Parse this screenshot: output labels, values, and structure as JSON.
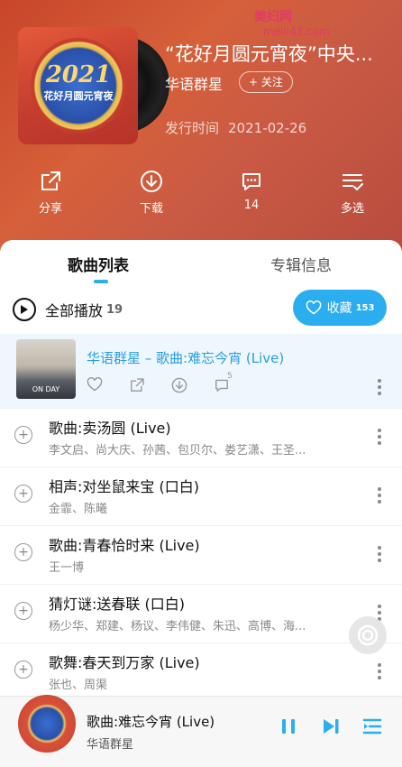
{
  "watermark": {
    "line1": "美妇网",
    "line2": "meili43.com"
  },
  "album": {
    "title": "“花好月圆元宵夜”中央...",
    "artist": "华语群星",
    "follow_label": "+ 关注",
    "release_label": "发行时间",
    "release_date": "2021-02-26",
    "cover_year": "2021",
    "cover_text": "花好月圆元宵夜"
  },
  "actions": [
    {
      "label": "分享",
      "icon": "share-icon"
    },
    {
      "label": "下载",
      "icon": "download-icon"
    },
    {
      "label": "14",
      "icon": "comment-icon"
    },
    {
      "label": "多选",
      "icon": "multi-select-icon"
    }
  ],
  "tabs": {
    "songs": "歌曲列表",
    "album_info": "专辑信息"
  },
  "play_all": {
    "label": "全部播放",
    "count": "19"
  },
  "collect": {
    "label": "收藏",
    "count": "153"
  },
  "now_playing": {
    "title": "华语群星 – 歌曲:难忘今宵 (Live)",
    "comment_count": "5",
    "thumb_text": "ON DAY"
  },
  "songs": [
    {
      "name": "歌曲:卖汤圆 (Live)",
      "singers": "李文启、尚大庆、孙茜、包贝尔、娄艺潇、王圣..."
    },
    {
      "name": "相声:对坐鼠来宝 (口白)",
      "singers": "金霏、陈曦"
    },
    {
      "name": "歌曲:青春恰时来 (Live)",
      "singers": "王一博"
    },
    {
      "name": "猜灯谜:送春联 (口白)",
      "singers": "杨少华、郑建、杨议、李伟健、朱迅、高博、海..."
    },
    {
      "name": "歌舞:春天到万家 (Live)",
      "singers": "张也、周渠"
    }
  ],
  "player": {
    "title": "歌曲:难忘今宵 (Live)",
    "artist": "华语群星"
  },
  "colors": {
    "accent": "#2aaef0",
    "header": "#d05a3a"
  }
}
